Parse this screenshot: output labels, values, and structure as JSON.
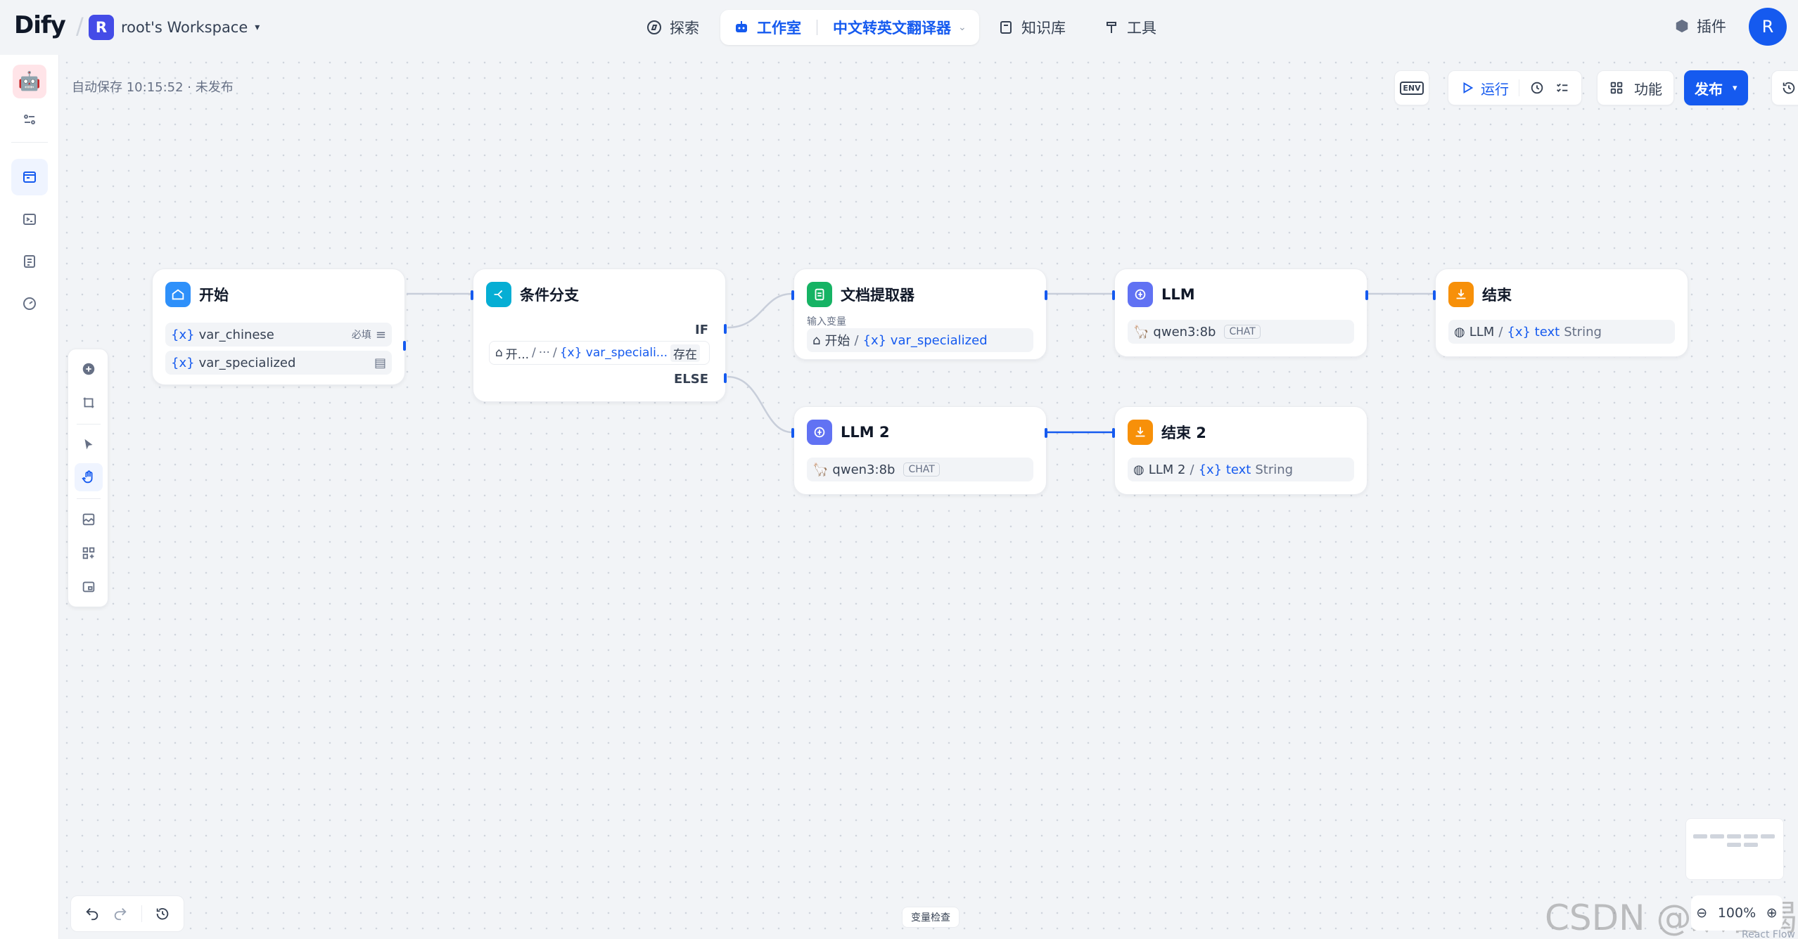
{
  "header": {
    "logo": "Dify",
    "workspace_initial": "R",
    "workspace_name": "root's Workspace",
    "nav": {
      "explore": "探索",
      "studio": "工作室",
      "app_name": "中文转英文翻译器",
      "knowledge": "知识库",
      "tools": "工具"
    },
    "plugin": "插件",
    "avatar": "R"
  },
  "canvas": {
    "autosave": "自动保存 10:15:52 · 未发布",
    "toolbar": {
      "env": "ENV",
      "run": "运行",
      "features": "功能",
      "publish": "发布"
    },
    "var_check": "变量检查",
    "zoom": "100%",
    "react_flow": "React Flow",
    "watermark": "CSDN @趴着喝可乐"
  },
  "nodes": {
    "start": {
      "title": "开始",
      "vars": [
        {
          "prefix": "{x}",
          "name": "var_chinese",
          "badge": "必填"
        },
        {
          "prefix": "{x}",
          "name": "var_specialized",
          "badge": ""
        }
      ]
    },
    "ifelse": {
      "title": "条件分支",
      "if_label": "IF",
      "else_label": "ELSE",
      "cond_source": "开...",
      "cond_sep": "/",
      "cond_ellipsis": "···",
      "cond_var": "{x} var_speciali...",
      "cond_op": "存在"
    },
    "doc": {
      "title": "文档提取器",
      "input_label": "输入变量",
      "source": "开始",
      "var": "{x} var_specialized"
    },
    "llm1": {
      "title": "LLM",
      "model": "qwen3:8b",
      "tag": "CHAT"
    },
    "llm2": {
      "title": "LLM 2",
      "model": "qwen3:8b",
      "tag": "CHAT"
    },
    "end1": {
      "title": "结束",
      "source": "LLM",
      "var": "{x} text",
      "type": "String"
    },
    "end2": {
      "title": "结束 2",
      "source": "LLM 2",
      "var": "{x} text",
      "type": "String"
    }
  },
  "colors": {
    "accent": "#155aef",
    "start": "#2e90fa",
    "ifelse": "#06aed4",
    "doc": "#16b364",
    "llm": "#6172f3",
    "end": "#f79009"
  }
}
